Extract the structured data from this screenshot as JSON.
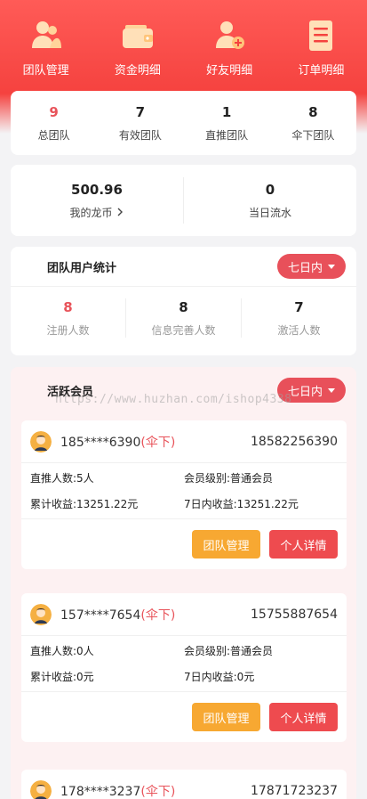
{
  "nav": [
    {
      "label": "团队管理",
      "icon": "team-icon"
    },
    {
      "label": "资金明细",
      "icon": "wallet-icon"
    },
    {
      "label": "好友明细",
      "icon": "add-friend-icon"
    },
    {
      "label": "订单明细",
      "icon": "order-list-icon"
    }
  ],
  "summary": [
    {
      "value": "9",
      "label": "总团队"
    },
    {
      "value": "7",
      "label": "有效团队"
    },
    {
      "value": "1",
      "label": "直推团队"
    },
    {
      "value": "8",
      "label": "伞下团队"
    }
  ],
  "coins": {
    "balance_value": "500.96",
    "balance_label": "我的龙币",
    "flow_value": "0",
    "flow_label": "当日流水"
  },
  "team_stats": {
    "title": "团队用户统计",
    "range": "七日内",
    "items": [
      {
        "value": "8",
        "label": "注册人数"
      },
      {
        "value": "8",
        "label": "信息完善人数"
      },
      {
        "value": "7",
        "label": "激活人数"
      }
    ]
  },
  "active": {
    "title": "活跃会员",
    "range": "七日内",
    "watermark": "https://www.huzhan.com/ishop4338",
    "members": [
      {
        "name": "185****6390",
        "tag": "(伞下)",
        "phone": "18582256390",
        "direct": "直推人数:5人",
        "level": "会员级别:普通会员",
        "total": "累计收益:13251.22元",
        "week": "7日内收益:13251.22元"
      },
      {
        "name": "157****7654",
        "tag": "(伞下)",
        "phone": "15755887654",
        "direct": "直推人数:0人",
        "level": "会员级别:普通会员",
        "total": "累计收益:0元",
        "week": "7日内收益:0元"
      },
      {
        "name": "178****3237",
        "tag": "(伞下)",
        "phone": "17871723237"
      }
    ],
    "btn_manage": "团队管理",
    "btn_detail": "个人详情"
  },
  "colors": {
    "brand": "#f5423f",
    "accent_red": "#e8535a",
    "orange": "#f7a832"
  }
}
